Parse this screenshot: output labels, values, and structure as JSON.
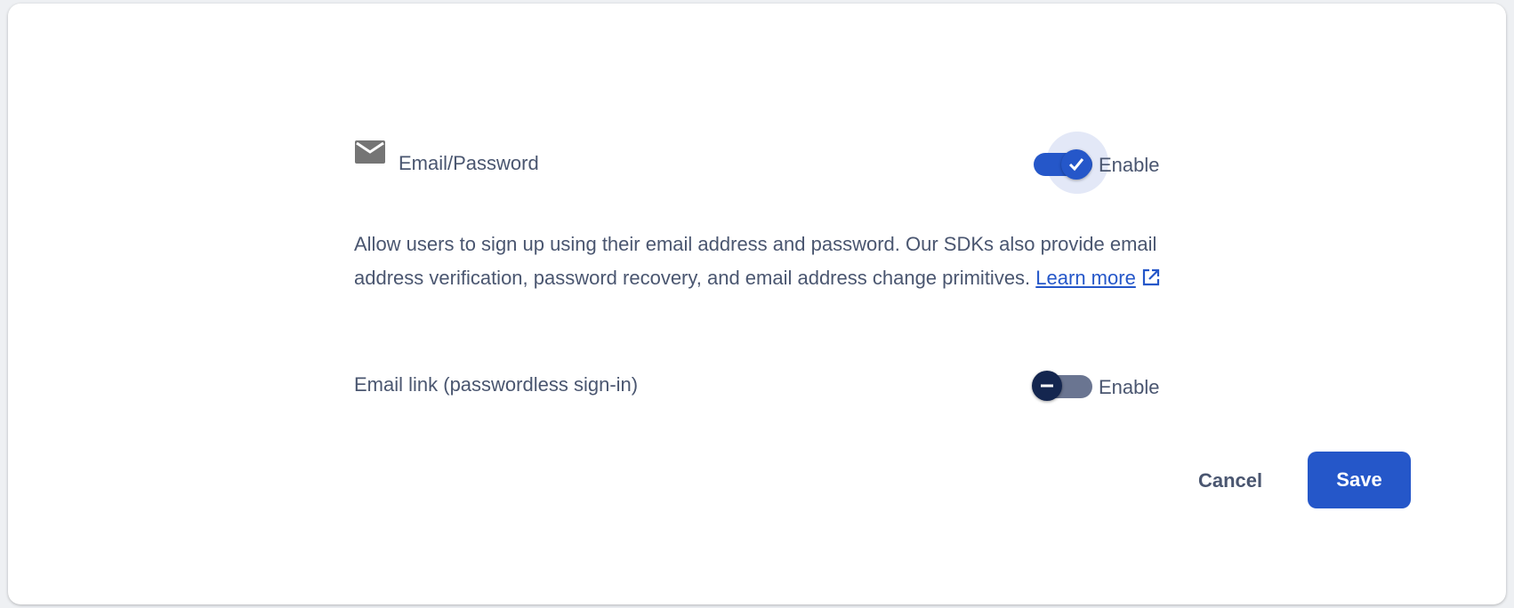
{
  "providers": [
    {
      "name": "Email/Password",
      "icon": "mail-icon",
      "enabled": true,
      "toggle_label": "Enable"
    },
    {
      "name": "Email link (passwordless sign-in)",
      "enabled": false,
      "toggle_label": "Enable"
    }
  ],
  "description": {
    "text": "Allow users to sign up using their email address and password. Our SDKs also provide email address verification, password recovery, and email address change primitives.",
    "link_label": "Learn more"
  },
  "actions": {
    "cancel_label": "Cancel",
    "save_label": "Save"
  },
  "colors": {
    "accent": "#2557c9",
    "text": "#4a5670",
    "toggle_off_knob": "#14264f"
  }
}
